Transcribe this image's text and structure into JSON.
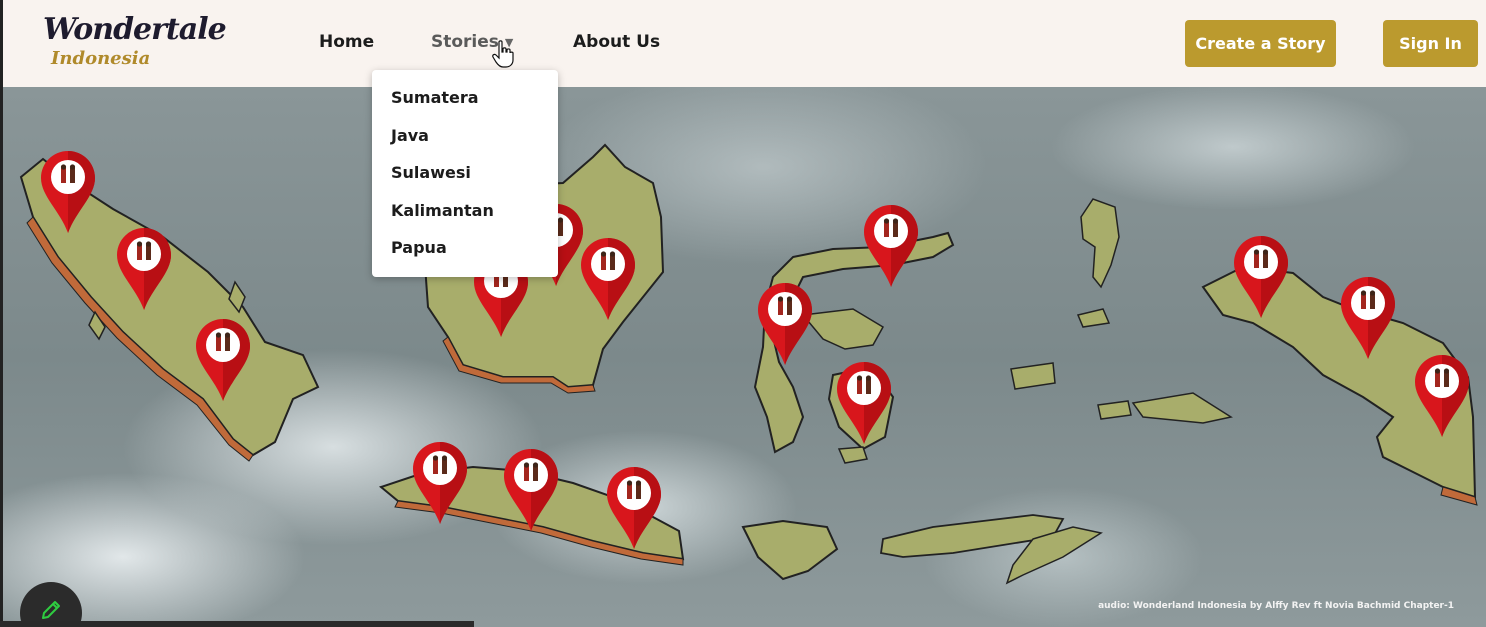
{
  "brand": {
    "line1": "Wondertale",
    "line2": "Indonesia"
  },
  "nav": {
    "home": "Home",
    "stories": "Stories",
    "about": "About Us"
  },
  "actions": {
    "create_story": "Create a Story",
    "sign_in": "Sign In"
  },
  "stories_menu": {
    "items": [
      "Sumatera",
      "Java",
      "Sulawesi",
      "Kalimantan",
      "Papua"
    ]
  },
  "map": {
    "credit": "audio: Wonderland Indonesia by Alffy Rev ft Novia Bachmid Chapter-1"
  },
  "colors": {
    "header_bg": "#f9f3ef",
    "accent": "#bb9a2e",
    "pin": "#d8161c",
    "land": "#a8ad6b"
  }
}
